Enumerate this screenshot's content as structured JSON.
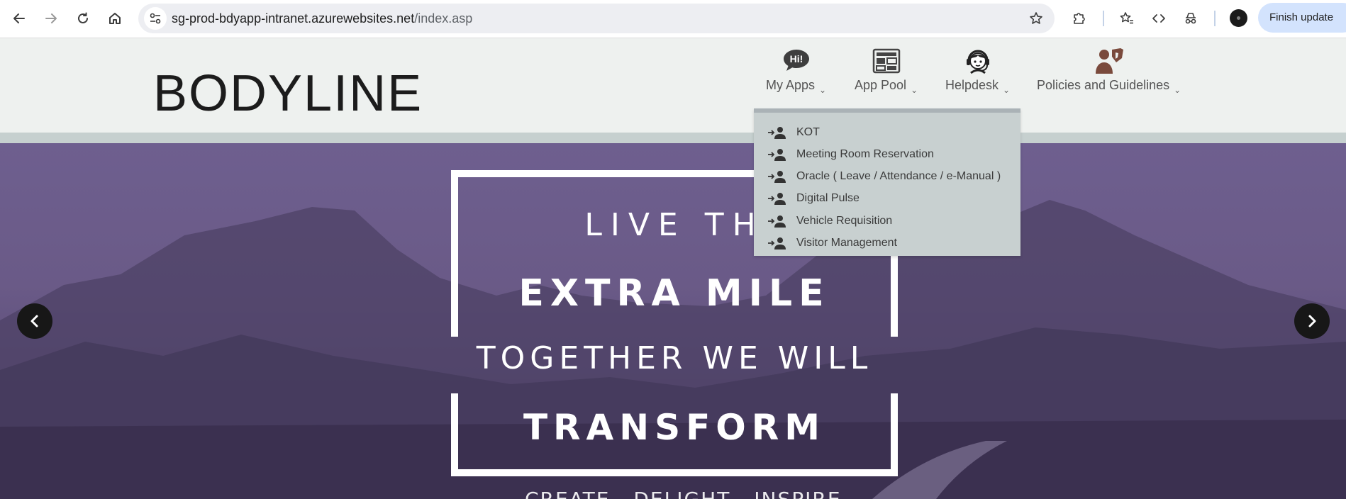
{
  "browser": {
    "url_domain": "sg-prod-bdyapp-intranet.azurewebsites.net",
    "url_path": "/index.asp",
    "finish_update_label": "Finish update"
  },
  "site": {
    "logo_text": "BODYLINE",
    "nav": [
      {
        "label": "My Apps",
        "icon": "hi-speech-bubble-icon"
      },
      {
        "label": "App Pool",
        "icon": "app-grid-icon"
      },
      {
        "label": "Helpdesk",
        "icon": "headset-agent-icon"
      },
      {
        "label": "Policies and Guidelines",
        "icon": "people-shield-icon"
      }
    ],
    "dropdown": [
      {
        "label": "KOT",
        "icon": "login-user-icon"
      },
      {
        "label": "Meeting Room Reservation",
        "icon": "login-user-icon"
      },
      {
        "label": "Oracle ( Leave / Attendance / e-Manual )",
        "icon": "login-user-icon"
      },
      {
        "label": "Digital Pulse",
        "icon": "login-user-icon"
      },
      {
        "label": "Vehicle Requisition",
        "icon": "login-user-icon"
      },
      {
        "label": "Visitor Management",
        "icon": "login-user-icon"
      }
    ]
  },
  "hero": {
    "line1": "LIVE TH",
    "line2": "EXTRA MILE",
    "line3": "TOGETHER WE WILL",
    "line4": "TRANSFORM",
    "tagline": "CREATE DELIGHT INSPIRE"
  },
  "colors": {
    "header_bg": "#eef1ef",
    "dropdown_bg": "#c8d0d0",
    "hero_tint": "#6a5a87",
    "finish_update_bg": "#d3e3fd"
  }
}
